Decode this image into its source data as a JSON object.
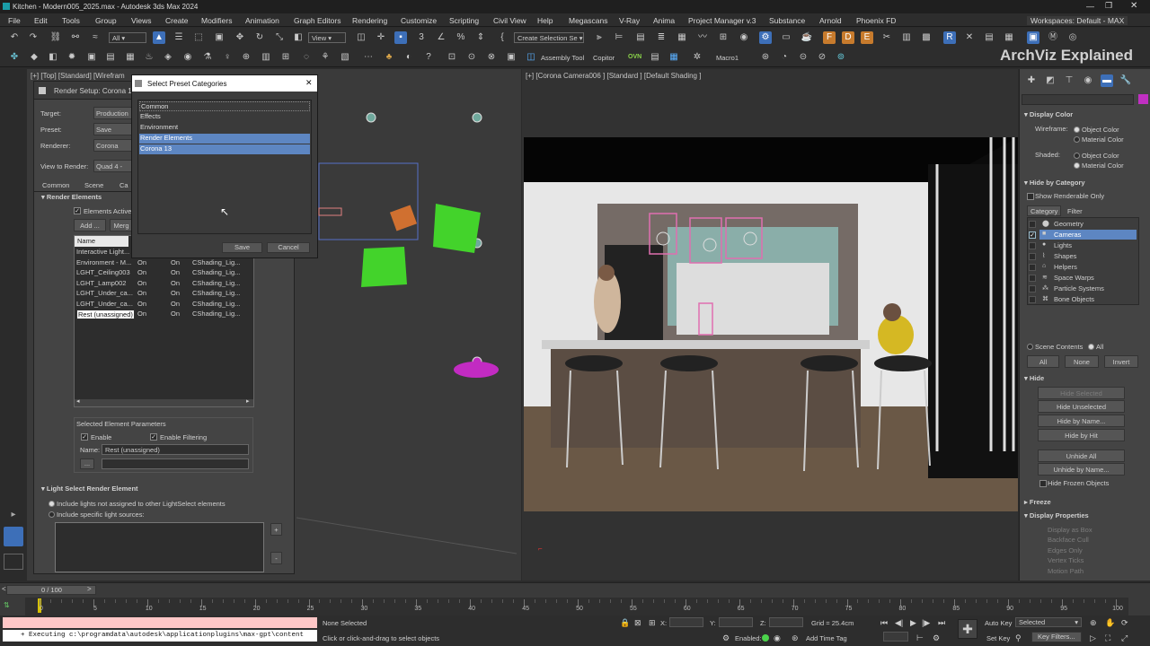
{
  "window": {
    "title": "Kitchen - Modern005_2025.max - Autodesk 3ds Max 2024",
    "workspace": "Workspaces: Default - MAX"
  },
  "menu": [
    "File",
    "Edit",
    "Tools",
    "Group",
    "Views",
    "Create",
    "Modifiers",
    "Animation",
    "Graph Editors",
    "Rendering",
    "Customize",
    "Scripting",
    "Civil View",
    "Help",
    "Megascans",
    "V-Ray",
    "Anima",
    "Project Manager v.3",
    "Substance",
    "Arnold",
    "Phoenix FD"
  ],
  "toolbar": {
    "filter": "All",
    "view": "View",
    "selection_set": "Create Selection Se",
    "assembly": "Assembly Tool",
    "copitor": "Copitor",
    "ovn": "OVN",
    "macro": "Macro1"
  },
  "brand": "ArchViz Explained",
  "viewport_left": {
    "label": "[+] [Top] [Standard] [Wirefram"
  },
  "viewport_right": {
    "label": "[+] [Corona Camera006 ] [Standard ] [Default Shading ]"
  },
  "render_setup": {
    "title": "Render Setup: Corona 13",
    "target_label": "Target:",
    "target_value": "Production R",
    "preset_label": "Preset:",
    "preset_value": "Save Preset",
    "renderer_label": "Renderer:",
    "renderer_value": "Corona",
    "view_label": "View to Render:",
    "view_value": "Quad 4 - Co",
    "tabs": [
      "Common",
      "Scene",
      "Ca"
    ],
    "render_elements_title": "Render Elements",
    "elements_active": "Elements Active",
    "add": "Add ...",
    "merge": "Merg",
    "col_name": "Name",
    "rows": [
      {
        "name": "Interactive Light...",
        "a": "",
        "b": "",
        "c": ""
      },
      {
        "name": "Environment - M...",
        "a": "On",
        "b": "On",
        "c": "CShading_Lig..."
      },
      {
        "name": "LGHT_Ceiling003",
        "a": "On",
        "b": "On",
        "c": "CShading_Lig..."
      },
      {
        "name": "LGHT_Lamp002",
        "a": "On",
        "b": "On",
        "c": "CShading_Lig..."
      },
      {
        "name": "LGHT_Under_ca...",
        "a": "On",
        "b": "On",
        "c": "CShading_Lig..."
      },
      {
        "name": "LGHT_Under_ca...",
        "a": "On",
        "b": "On",
        "c": "CShading_Lig..."
      },
      {
        "name": "Rest (unassigned)",
        "a": "On",
        "b": "On",
        "c": "CShading_Lig..."
      }
    ],
    "sel_params_title": "Selected Element Parameters",
    "enable": "Enable",
    "enable_filtering": "Enable Filtering",
    "name_label": "Name:",
    "name_value": "Rest (unassigned)",
    "browse": "...",
    "lightselect_title": "Light Select Render Element",
    "opt1": "Include lights not assigned to other LightSelect elements",
    "opt2": "Include specific light sources:",
    "plus": "+",
    "minus": "-"
  },
  "preset_dialog": {
    "title": "Select Preset Categories",
    "items": [
      "Common",
      "Effects",
      "Environment",
      "Render Elements",
      "Corona 13"
    ],
    "save": "Save",
    "cancel": "Cancel",
    "close": "✕"
  },
  "right_panel": {
    "display_color": "Display Color",
    "wireframe": "Wireframe:",
    "shaded": "Shaded:",
    "object_color": "Object Color",
    "material_color": "Material Color",
    "hide_by_category": "Hide by Category",
    "show_renderable": "Show Renderable Only",
    "tab_category": "Category",
    "tab_filter": "Filter",
    "categories": [
      "Geometry",
      "Cameras",
      "Lights",
      "Shapes",
      "Helpers",
      "Space Warps",
      "Particle Systems",
      "Bone Objects"
    ],
    "scene_contents": "Scene Contents",
    "all_radio": "All",
    "btn_all": "All",
    "btn_none": "None",
    "btn_invert": "Invert",
    "hide": "Hide",
    "hide_buttons": [
      "Hide Selected",
      "Hide Unselected",
      "Hide by Name...",
      "Hide by Hit",
      "Unhide All",
      "Unhide by Name..."
    ],
    "hide_frozen": "Hide Frozen Objects",
    "freeze": "Freeze",
    "display_properties": "Display Properties",
    "props": [
      "Display as Box",
      "Backface Cull",
      "Edges Only",
      "Vertex Ticks",
      "Motion Path"
    ]
  },
  "timeline": {
    "frame": "0 / 100",
    "ticks": [
      "0",
      "5",
      "10",
      "15",
      "20",
      "25",
      "30",
      "35",
      "40",
      "45",
      "50",
      "55",
      "60",
      "65",
      "70",
      "75",
      "80",
      "85",
      "90",
      "95",
      "100"
    ]
  },
  "status": {
    "script": "+ Executing c:\\programdata\\autodesk\\applicationplugins\\max-gpt\\content",
    "selected": "None Selected",
    "hint": "Click or click-and-drag to select objects",
    "x": "X:",
    "y": "Y:",
    "z": "Z:",
    "grid": "Grid = 25.4cm",
    "enabled": "Enabled:",
    "add_time_tag": "Add Time Tag",
    "auto_key": "Auto Key",
    "set_key": "Set Key",
    "selected_dd": "Selected",
    "key_filters": "Key Filters..."
  }
}
